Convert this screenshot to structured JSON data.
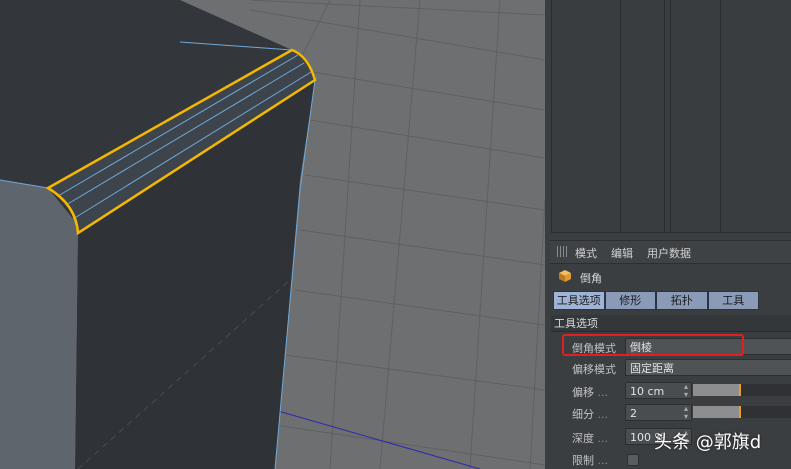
{
  "menubar": {
    "items": [
      "模式",
      "编辑",
      "用户数据"
    ]
  },
  "object": {
    "icon": "cube-icon",
    "name": "倒角"
  },
  "tabs": [
    {
      "label": "工具选项",
      "active": true
    },
    {
      "label": "修形",
      "active": false
    },
    {
      "label": "拓扑",
      "active": false
    },
    {
      "label": "工具",
      "active": false
    }
  ],
  "section": {
    "title": "工具选项"
  },
  "params": {
    "bevel_mode": {
      "label": "倒角模式",
      "value": "倒棱"
    },
    "offset_mode": {
      "label": "偏移模式",
      "value": "固定距离"
    },
    "offset": {
      "label": "偏移",
      "dots": "...",
      "value": "10 cm",
      "slider": 0.45
    },
    "subdivision": {
      "label": "细分",
      "dots": "...",
      "value": "2",
      "slider": 0.45
    },
    "depth": {
      "label": "深度",
      "dots": "...",
      "value": "100 %"
    },
    "limit": {
      "label": "限制",
      "dots": "...",
      "checked": false
    }
  },
  "watermark": "头条 @郭旗d",
  "colors": {
    "selection_edge": "#f5b800",
    "highlight_box": "#e02020",
    "tab_active": "#9fb3d6"
  }
}
